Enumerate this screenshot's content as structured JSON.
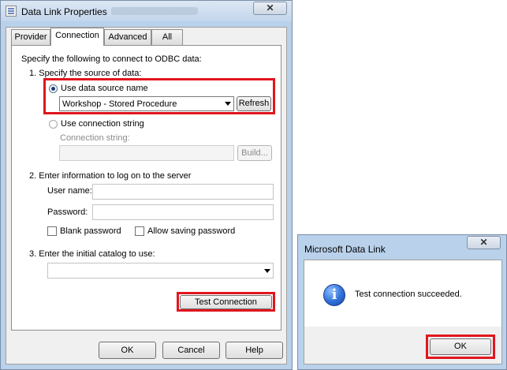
{
  "data_link_properties": {
    "title": "Data Link Properties",
    "close_symbol": "✕",
    "icon": "properties-window-icon",
    "tabs": [
      {
        "label": "Provider"
      },
      {
        "label": "Connection"
      },
      {
        "label": "Advanced"
      },
      {
        "label": "All"
      }
    ],
    "active_tab": "Connection",
    "connection": {
      "intro": "Specify the following to connect to ODBC data:",
      "step1": "1. Specify the source of data:",
      "use_dsn_label": "Use data source name",
      "dsn_value": "Workshop - Stored Procedure",
      "refresh_label": "Refresh",
      "use_conn_string_label": "Use connection string",
      "conn_string_label": "Connection string:",
      "build_label": "Build...",
      "step2": "2. Enter information to log on to the server",
      "username_label": "User name:",
      "password_label": "Password:",
      "blank_password_label": "Blank password",
      "allow_saving_label": "Allow saving password",
      "step3": "3. Enter the initial catalog to use:",
      "catalog_value": "",
      "test_connection_label": "Test Connection"
    },
    "buttons": {
      "ok": "OK",
      "cancel": "Cancel",
      "help": "Help"
    }
  },
  "microsoft_data_link": {
    "title": "Microsoft Data Link",
    "close_symbol": "✕",
    "icon": "information-icon",
    "icon_glyph": "i",
    "message": "Test connection succeeded.",
    "ok_label": "OK"
  },
  "colors": {
    "highlight": "#e0161f",
    "window_frame": "#b9d1ea"
  }
}
